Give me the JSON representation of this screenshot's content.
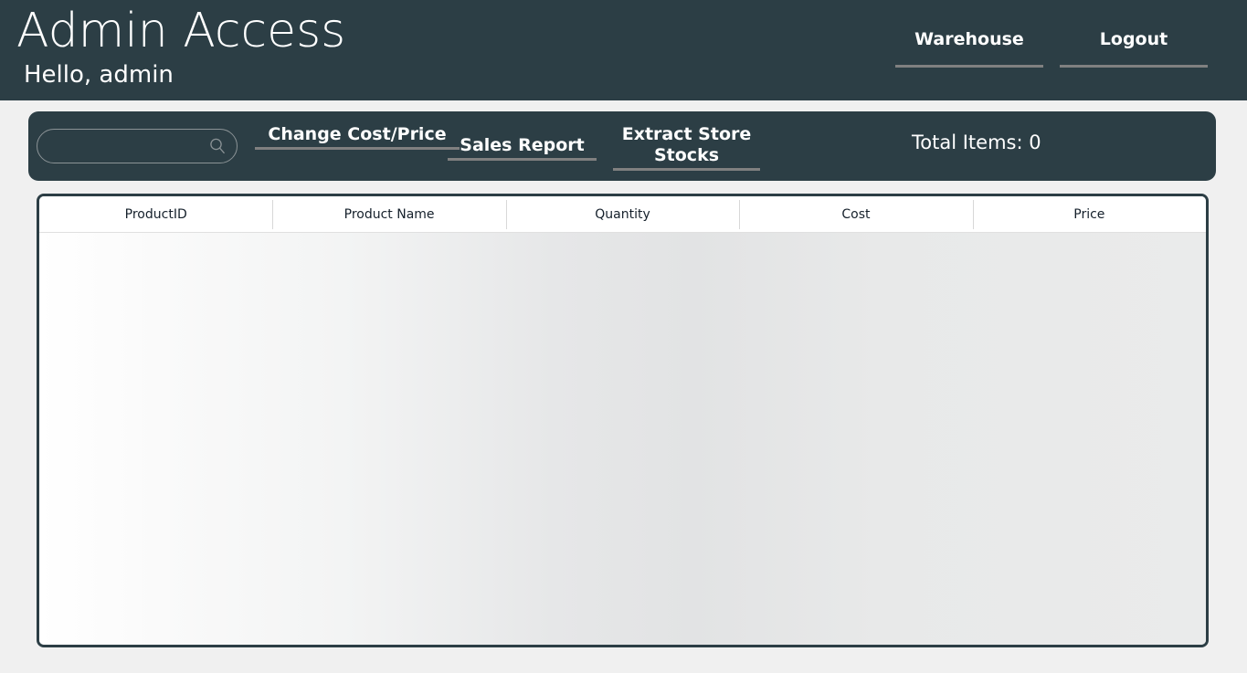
{
  "header": {
    "title": "Admin Access",
    "greeting": "Hello, admin",
    "nav": [
      {
        "label": "Warehouse",
        "name": "warehouse"
      },
      {
        "label": "Logout",
        "name": "logout"
      }
    ]
  },
  "toolbar": {
    "search": {
      "value": "",
      "placeholder": "",
      "icon": "search-icon"
    },
    "buttons": [
      {
        "label": "Change Cost/Price",
        "name": "change-cost-price"
      },
      {
        "label": "Sales Report",
        "name": "sales-report"
      },
      {
        "label": "Extract Store Stocks",
        "name": "extract-store-stocks"
      }
    ],
    "total_items_label": "Total Items: 0",
    "total_items_count": 0
  },
  "table": {
    "columns": [
      "ProductID",
      "Product Name",
      "Quantity",
      "Cost",
      "Price"
    ],
    "rows": [],
    "row_count": 0
  },
  "colors": {
    "brand_dark": "#2c3e45",
    "page_background": "#f0f0f0",
    "underline_gray": "#808080",
    "search_border": "#8b9396",
    "text_light": "#ffffff",
    "table_text": "#15202b"
  }
}
